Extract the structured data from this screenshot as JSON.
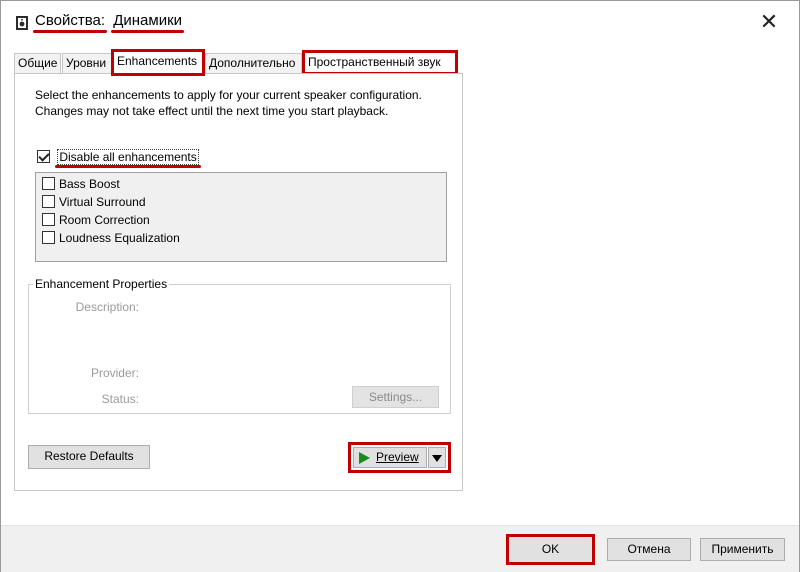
{
  "window": {
    "title_prefix": "Свойства:",
    "title_device": "Динамики",
    "icon": "speaker-icon",
    "close_glyph": "✕"
  },
  "tabs": [
    {
      "label": "Общие"
    },
    {
      "label": "Уровни"
    },
    {
      "label": "Enhancements",
      "active": true
    },
    {
      "label": "Дополнительно"
    },
    {
      "label": "Пространственный звук"
    }
  ],
  "enhancements": {
    "description": "Select the enhancements to apply for your current speaker configuration. Changes may not take effect until the next time you start playback.",
    "disable_all_label": "Disable all enhancements",
    "disable_all_checked": true,
    "items": [
      {
        "label": "Bass Boost",
        "checked": false
      },
      {
        "label": "Virtual Surround",
        "checked": false
      },
      {
        "label": "Room Correction",
        "checked": false
      },
      {
        "label": "Loudness Equalization",
        "checked": false
      }
    ]
  },
  "properties": {
    "legend": "Enhancement Properties",
    "description_label": "Description:",
    "provider_label": "Provider:",
    "status_label": "Status:",
    "settings_button": "Settings..."
  },
  "buttons": {
    "restore_defaults": "Restore Defaults",
    "preview": "Preview",
    "ok": "OK",
    "cancel": "Отмена",
    "apply": "Применить"
  },
  "colors": {
    "highlight_red": "#c00000",
    "play_green": "#1a8c1a"
  }
}
